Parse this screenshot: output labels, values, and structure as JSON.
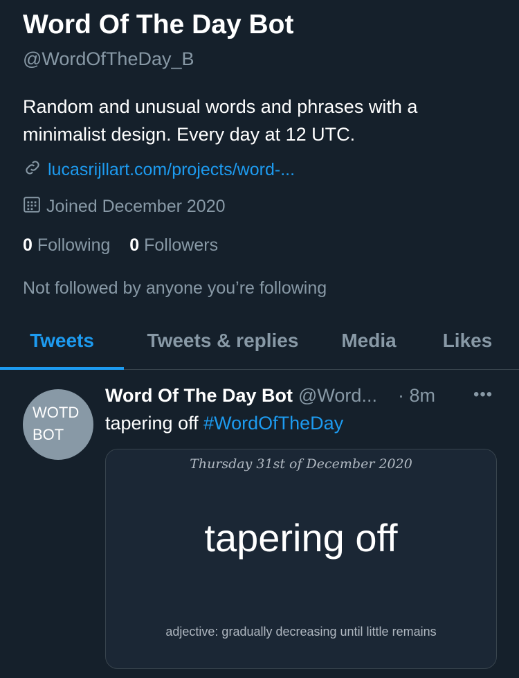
{
  "profile": {
    "name": "Word Of The Day Bot",
    "handle": "@WordOfTheDay_B",
    "bio": "Random and unusual words and phrases with a minimalist design. Every day at 12 UTC.",
    "link": "lucasrijllart.com/projects/word-...",
    "joined": "Joined December 2020",
    "following_count": "0",
    "following_label": "Following",
    "followers_count": "0",
    "followers_label": "Followers",
    "not_followed": "Not followed by anyone you’re following"
  },
  "tabs": [
    "Tweets",
    "Tweets & replies",
    "Media",
    "Likes"
  ],
  "tweet": {
    "avatar_text": "WOTD BOT",
    "name": "Word Of The Day Bot",
    "handle": "@Word...",
    "time": "· 8m",
    "more": "•••",
    "text": "tapering off ",
    "hashtag": "#WordOfTheDay",
    "card": {
      "date": "Thursday 31st of December 2020",
      "word": "tapering off",
      "definition": "adjective: gradually decreasing until little remains"
    }
  },
  "colors": {
    "accent": "#1d9bf0",
    "background": "#15202b"
  }
}
